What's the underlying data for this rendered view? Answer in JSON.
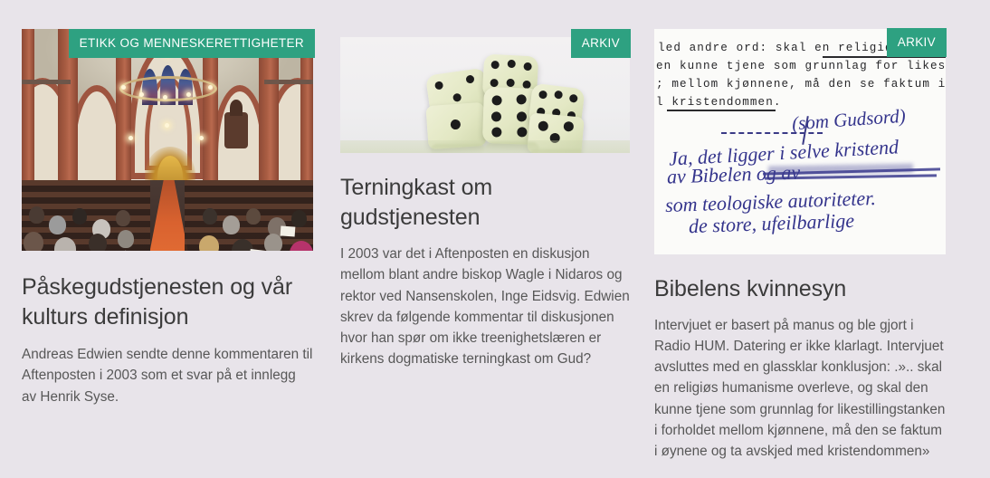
{
  "page": {
    "background_color": "#e8e4ea",
    "badge_color": "#2ea181",
    "title_color": "#3b3b3b",
    "body_color": "#575757"
  },
  "cards": [
    {
      "badge": "ETIKK OG MENNESKERETTIGHETER",
      "image_name": "church-interior-photo",
      "title": "Påskegudstjenesten og vår kulturs definisjon",
      "excerpt": "Andreas Edwien sendte denne kommentaren til Aftenposten i 2003 som et svar på et innlegg av Henrik Syse."
    },
    {
      "badge": "ARKIV",
      "image_name": "dice-photo",
      "title": "Terningkast om gudstjenesten",
      "excerpt": "I 2003 var det i Aftenposten en diskusjon mellom blant andre biskop Wagle i Nidaros og rektor ved Nansenskolen, Inge Eidsvig. Edwien skrev da følgende kommentar til diskusjonen hvor han spør om ikke treenighetslæren er kirkens dogmatiske terningkast om Gud?"
    },
    {
      "badge": "ARKIV",
      "image_name": "handwritten-manuscript-photo",
      "title": "Bibelens kvinnesyn",
      "excerpt": "Intervjuet er basert på manus og ble gjort i Radio HUM. Datering er ikke klarlagt. Intervjuet avsluttes med en glassklar konklusjon: .».. skal en religiøs humanisme overleve, og skal den kunne tjene som grunnlag for likestillingstanken i forholdet mellom kjønnene, må den se faktum i øynene og ta avskjed med kristendommen»"
    }
  ],
  "manuscript_text": {
    "typed_lines": [
      "led andre ord: skal en religiøs hum",
      "en kunne tjene som grunnlag for likestil",
      "; mellom kjønnene, må den se faktum i øy",
      "l kristendommen."
    ],
    "handwritten_lines": [
      "(som Gudsord)",
      "Ja, det ligger i selve kristend",
      "av Bibelen og av",
      "som teologiske autoriteter.",
      "de store, ufeilbarlige"
    ]
  }
}
